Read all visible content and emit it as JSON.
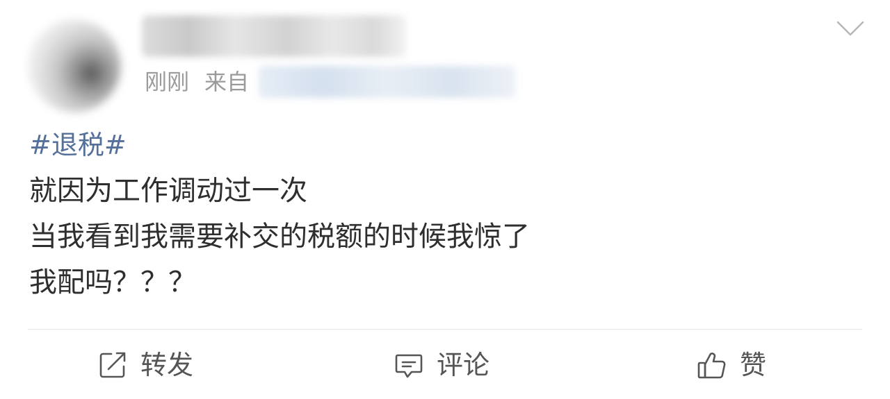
{
  "post": {
    "time": "刚刚",
    "source_prefix": "来自",
    "hashtag": "#退税#",
    "lines": [
      "就因为工作调动过一次",
      "当我看到我需要补交的税额的时候我惊了",
      "我配吗？？？"
    ]
  },
  "actions": {
    "repost_label": "转发",
    "comment_label": "评论",
    "like_label": "赞"
  },
  "colors": {
    "hashtag": "#54709a",
    "meta_text": "#9a9a9a",
    "body_text": "#2e2e2e",
    "divider": "#e6e6e6"
  },
  "icons": {
    "menu": "chevron-down-icon",
    "repost": "repost-icon",
    "comment": "comment-icon",
    "like": "thumbs-up-icon"
  }
}
